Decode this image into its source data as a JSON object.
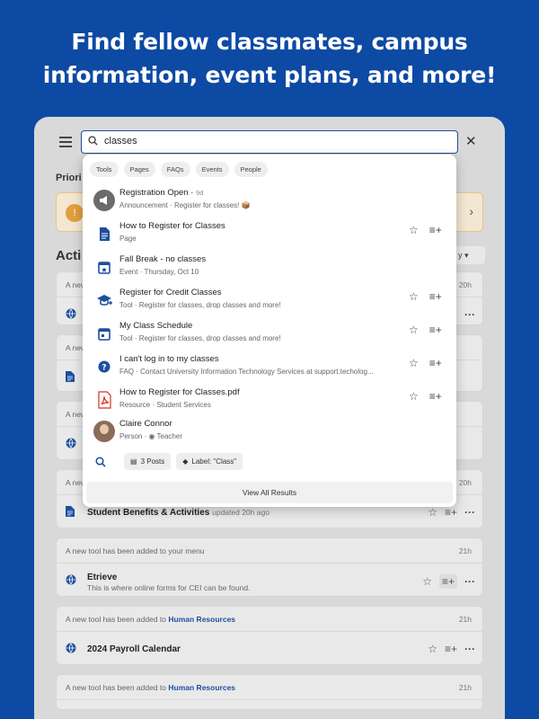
{
  "headline": {
    "line1": "Find fellow classmates, campus",
    "line2": "information, event plans, and more!"
  },
  "search": {
    "query": "classes"
  },
  "sections": {
    "priority": "Priori",
    "activity": "Acti",
    "sort": "y"
  },
  "filters": [
    "Tools",
    "Pages",
    "FAQs",
    "Events",
    "People"
  ],
  "results": [
    {
      "title": "Registration Open",
      "age": "9d",
      "type": "Announcement",
      "detail": "Register for classes! 📦",
      "icon": "megaphone-icon",
      "actions": false
    },
    {
      "title": "How to Register for Classes",
      "type": "Page",
      "detail": "",
      "icon": "document-icon",
      "actions": true
    },
    {
      "title": "Fall Break - no classes",
      "type": "Event",
      "detail": "Thursday, Oct 10",
      "icon": "calendar-event-icon",
      "actions": false
    },
    {
      "title": "Register for Credit Classes",
      "type": "Tool",
      "detail": "Register for classes, drop classes and more!",
      "icon": "graduation-cap-icon",
      "actions": true
    },
    {
      "title": "My Class Schedule",
      "type": "Tool",
      "detail": "Register for classes, drop classes and more!",
      "icon": "calendar-icon",
      "actions": true
    },
    {
      "title": "I can't log in to my classes",
      "type": "FAQ",
      "detail": "Contact University Information Technology Services at support.techolog...",
      "icon": "help-icon",
      "actions": true
    },
    {
      "title": "How to Register for Classes.pdf",
      "type": "Resource",
      "detail": "Student Services",
      "icon": "pdf-icon",
      "actions": true
    },
    {
      "title": "Claire Connor",
      "type": "Person",
      "detail": "Teacher",
      "icon": "avatar",
      "actions": false
    }
  ],
  "bottom_chips": {
    "posts": "3 Posts",
    "label": "Label: \"Class\""
  },
  "view_all": "View All Results",
  "feed": [
    {
      "header": "A new",
      "time": "20h",
      "title": "",
      "subtitle": "",
      "icon": "globe-icon"
    },
    {
      "header": "A new",
      "time": "",
      "title": "",
      "subtitle": "",
      "icon": "document-icon"
    },
    {
      "header": "A new",
      "time": "",
      "title": "",
      "subtitle": "",
      "icon": "globe-icon"
    },
    {
      "header": "A new",
      "time": "20h",
      "title": "Student Benefits & Activities",
      "updated": "updated 20h ago",
      "icon": "document-icon"
    },
    {
      "header": "A new tool has been added to your menu",
      "time": "21h",
      "title": "Etrieve",
      "subtitle": "This is where online forms for CEI can be found.",
      "icon": "globe-icon"
    },
    {
      "header": "A new tool has been added to",
      "link": "Human Resources",
      "time": "21h",
      "title": "2024 Payroll Calendar",
      "subtitle": "",
      "icon": "globe-icon"
    },
    {
      "header": "A new tool has been added to",
      "link": "Human Resources",
      "time": "21h",
      "title": "",
      "subtitle": "",
      "icon": "globe-icon"
    }
  ],
  "colors": {
    "brand": "#0d4aa3",
    "accent": "#1d4f9e",
    "pdf": "#d3341c"
  }
}
